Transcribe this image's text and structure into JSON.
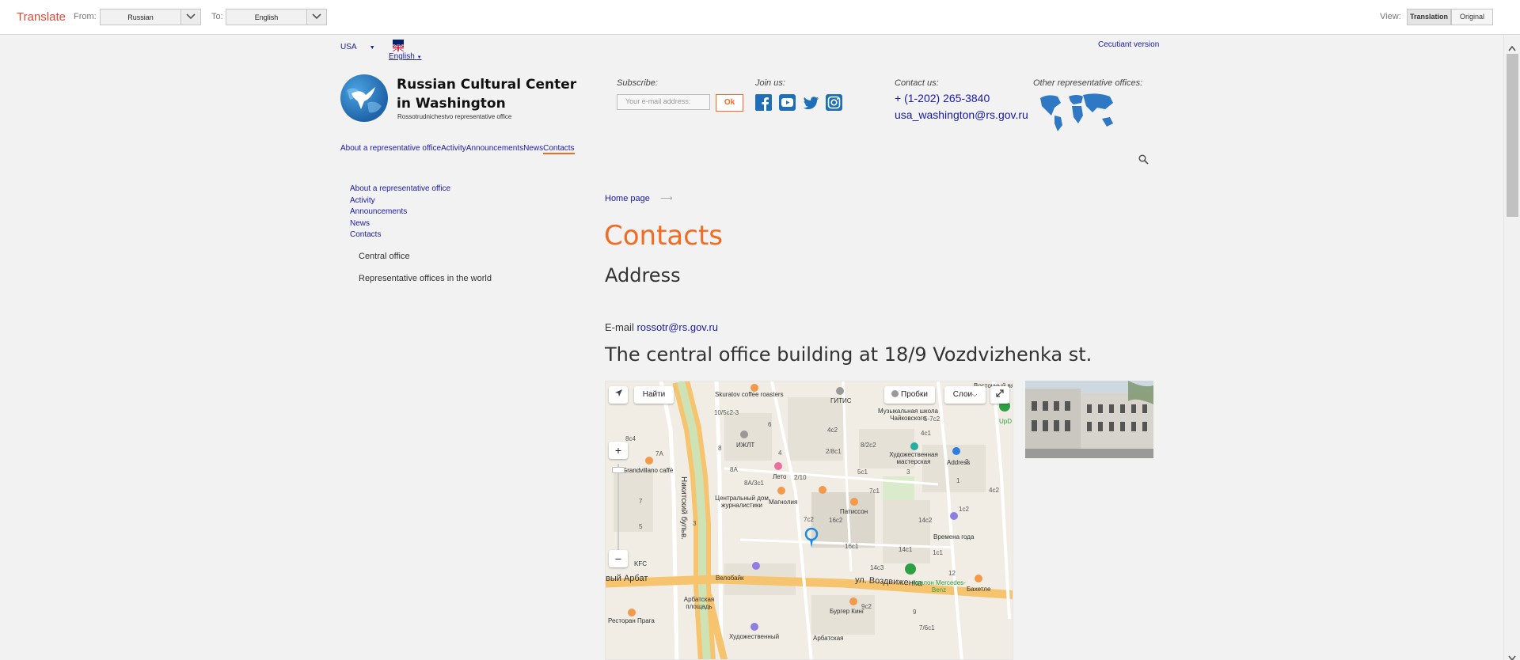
{
  "translate_bar": {
    "brand": "Translate",
    "from_label": "From:",
    "from_value": "Russian",
    "to_label": "To:",
    "to_value": "English",
    "view_label": "View:",
    "translation_btn": "Translation",
    "original_btn": "Original"
  },
  "header": {
    "region": "USA",
    "language": "English",
    "cecutiant": "Cecutiant version",
    "site_title": "Russian Cultural Center in Washington",
    "site_subtitle": "Rossotrudnichestvo representative office",
    "subscribe_label": "Subscribe:",
    "email_placeholder": "Your e-mail address:",
    "ok_label": "Ok",
    "join_label": "Join us:",
    "contact_label": "Contact us:",
    "phone": "+ (1-202) 265-3840",
    "email": "usa_washington@rs.gov.ru",
    "other_offices_label": "Other representative offices:"
  },
  "main_nav": [
    "About a representative office",
    "Activity",
    "Announcements",
    "News",
    "Contacts"
  ],
  "side_nav": {
    "items": [
      "About a representative office",
      "Activity",
      "Announcements",
      "News",
      "Contacts"
    ],
    "sub_items": [
      "Central office",
      "Representative offices in the world"
    ]
  },
  "content": {
    "breadcrumb": "Home page",
    "title": "Contacts",
    "address_heading": "Address",
    "email_prefix": "E-mail",
    "email_link": "rossotr@rs.gov.ru",
    "building_heading": "The central office building at 18/9 Vozdvizhenka st."
  },
  "map": {
    "find_btn": "Найти",
    "traffic_btn": "Пробки",
    "layers_btn": "Слои",
    "street_nikitsky": "Никитский бульв.",
    "street_vozdvizhenka": "ул. Воздвиженка",
    "street_arbat": "вый Арбат",
    "labels": [
      "Skuratov coffee roasters",
      "ГИТИС",
      "Музыкальная школа Чайковского",
      "Восточный вя",
      "ИЖЛТ",
      "Лето",
      "Центральный дом журналистики",
      "Магнолия",
      "Патиссон",
      "Художественная мастерская",
      "Address",
      "Времена года",
      "Велобайк",
      "KFC",
      "Авилон Mercedes-Benz",
      "Бахетле",
      "Бургер Кинг",
      "Арбатская площадь",
      "Ресторан Прага",
      "Художественный",
      "Арбатская",
      "Grandvillano caffè",
      "UpD"
    ],
    "numbers": [
      "10/5с2-3",
      "6",
      "4с2",
      "8/2с2",
      "5-7с2",
      "4с1",
      "8",
      "4",
      "8А",
      "8А/3с1",
      "2/10",
      "2/8с1",
      "5с1",
      "7с1",
      "2",
      "1",
      "14с2",
      "16с2",
      "16с1",
      "14с1",
      "1с1",
      "1с2",
      "14с3",
      "12",
      "9с2",
      "9",
      "7/6с1",
      "7с2",
      "5",
      "7",
      "3",
      "4с2",
      "8с4",
      "7А",
      "3"
    ]
  },
  "colors": {
    "accent": "#f26b21",
    "link": "#1a1aa8",
    "translate_brand": "#dd4b39",
    "social": "#1e6fb7"
  }
}
